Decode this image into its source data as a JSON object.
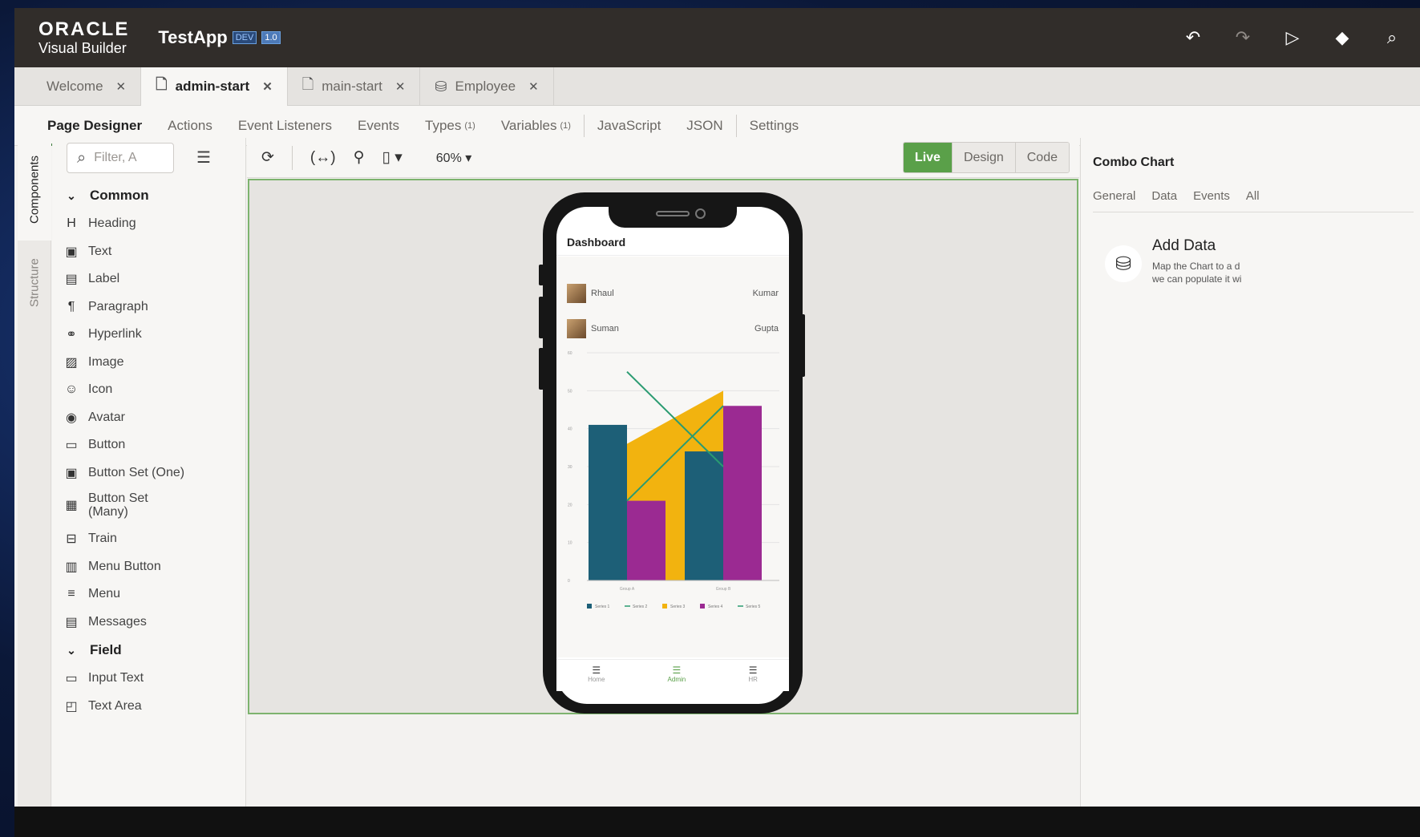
{
  "header": {
    "brand_line1": "ORACLE",
    "brand_line2": "Visual Builder",
    "app_name": "TestApp",
    "env_badge": "DEV",
    "version_badge": "1.0",
    "tools": [
      "undo-icon",
      "redo-icon",
      "play-icon",
      "git-icon",
      "search-icon"
    ]
  },
  "file_tabs": [
    {
      "label": "Welcome",
      "icon": "",
      "active": false
    },
    {
      "label": "admin-start",
      "icon": "page-icon",
      "active": true
    },
    {
      "label": "main-start",
      "icon": "page-icon",
      "active": false
    },
    {
      "label": "Employee",
      "icon": "database-icon",
      "active": false
    }
  ],
  "sub_tabs": {
    "page_designer": "Page Designer",
    "actions": "Actions",
    "event_listeners": "Event Listeners",
    "events": "Events",
    "types": "Types",
    "types_count": "(1)",
    "variables": "Variables",
    "variables_count": "(1)",
    "javascript": "JavaScript",
    "json": "JSON",
    "settings": "Settings"
  },
  "vertical_tabs": {
    "components": "Components",
    "structure": "Structure"
  },
  "palette": {
    "filter_placeholder": "Filter, A",
    "group_common": "Common",
    "group_field": "Field",
    "common_items": [
      "Heading",
      "Text",
      "Label",
      "Paragraph",
      "Hyperlink",
      "Image",
      "Icon",
      "Avatar",
      "Button",
      "Button Set (One)",
      "Button Set (Many)",
      "Train",
      "Menu Button",
      "Menu",
      "Messages"
    ],
    "field_items": [
      "Input Text",
      "Text Area"
    ]
  },
  "canvas_toolbar": {
    "zoom": "60%",
    "modes": [
      "Live",
      "Design",
      "Code"
    ],
    "active_mode": "Live"
  },
  "phone_screen": {
    "title": "Dashboard",
    "people": [
      {
        "first": "Rhaul",
        "last": "Kumar"
      },
      {
        "first": "Suman",
        "last": "Gupta"
      }
    ],
    "tabbar": [
      "Home",
      "Admin",
      "HR"
    ],
    "active_tab": "Admin"
  },
  "chart_data": {
    "type": "bar",
    "categories": [
      "Group A",
      "Group B"
    ],
    "ylim": [
      0,
      60
    ],
    "yticks": [
      0,
      10,
      20,
      30,
      40,
      50,
      60
    ],
    "series": [
      {
        "name": "Series 1",
        "type": "bar",
        "values": [
          41,
          34
        ],
        "color": "#1d5f77"
      },
      {
        "name": "Series 2",
        "type": "line",
        "values": [
          55,
          30
        ],
        "color": "#2a9b71"
      },
      {
        "name": "Series 3",
        "type": "area",
        "values": [
          36,
          50
        ],
        "color": "#f2b30f"
      },
      {
        "name": "Series 4",
        "type": "bar",
        "values": [
          21,
          46
        ],
        "color": "#9b2a92"
      },
      {
        "name": "Series 5",
        "type": "line",
        "values": [
          21,
          46
        ],
        "color": "#2a9b71"
      }
    ]
  },
  "right_panel": {
    "title": "Combo Chart",
    "tabs": [
      "General",
      "Data",
      "Events",
      "All"
    ],
    "add_data_title": "Add Data",
    "add_data_desc_line1": "Map the Chart to a d",
    "add_data_desc_line2": "we can populate it wi"
  }
}
